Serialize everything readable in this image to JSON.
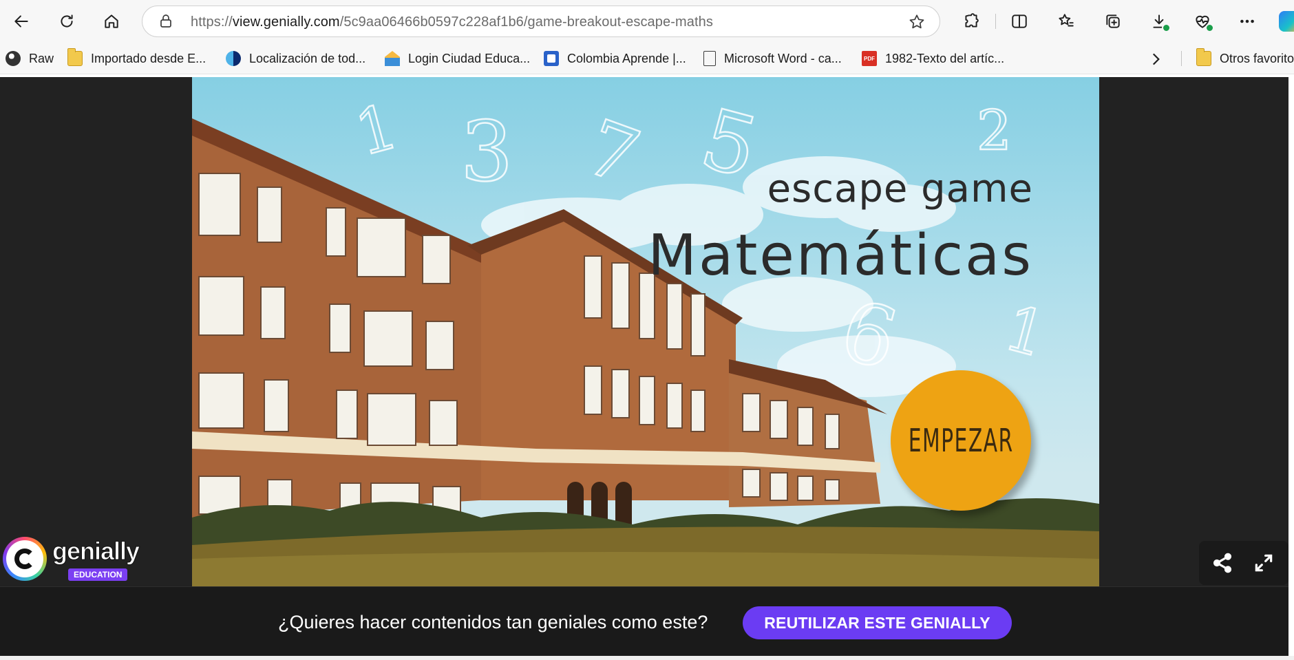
{
  "browser": {
    "url_prefix": "https://",
    "url_host": "view.genially.com",
    "url_path": "/5c9aa06466b0597c228af1b6/game-breakout-escape-maths"
  },
  "bookmarks": {
    "items": [
      {
        "label": "Raw",
        "icon": "raw-icon"
      },
      {
        "label": "Importado desde E...",
        "icon": "folder-icon"
      },
      {
        "label": "Localización de tod...",
        "icon": "site-icon"
      },
      {
        "label": "Login Ciudad Educa...",
        "icon": "site-icon"
      },
      {
        "label": "Colombia Aprende |...",
        "icon": "site-icon"
      },
      {
        "label": "Microsoft Word - ca...",
        "icon": "document-icon"
      },
      {
        "label": "1982-Texto del artíc...",
        "icon": "pdf-icon"
      }
    ],
    "other_favorites": "Otros favorito"
  },
  "presentation": {
    "title_small": "escape game",
    "title_large": "Matemáticas",
    "start_button": "EMPEZAR",
    "floating_digits": [
      "1",
      "3",
      "7",
      "5",
      "2",
      "6",
      "1"
    ],
    "accent_color": "#eea313"
  },
  "genially": {
    "brand": "genially",
    "badge": "EDUCATION"
  },
  "promo": {
    "question": "¿Quieres hacer contenidos tan geniales como este?",
    "cta": "REUTILIZAR ESTE GENIALLY",
    "cta_color": "#6b3cf3"
  }
}
